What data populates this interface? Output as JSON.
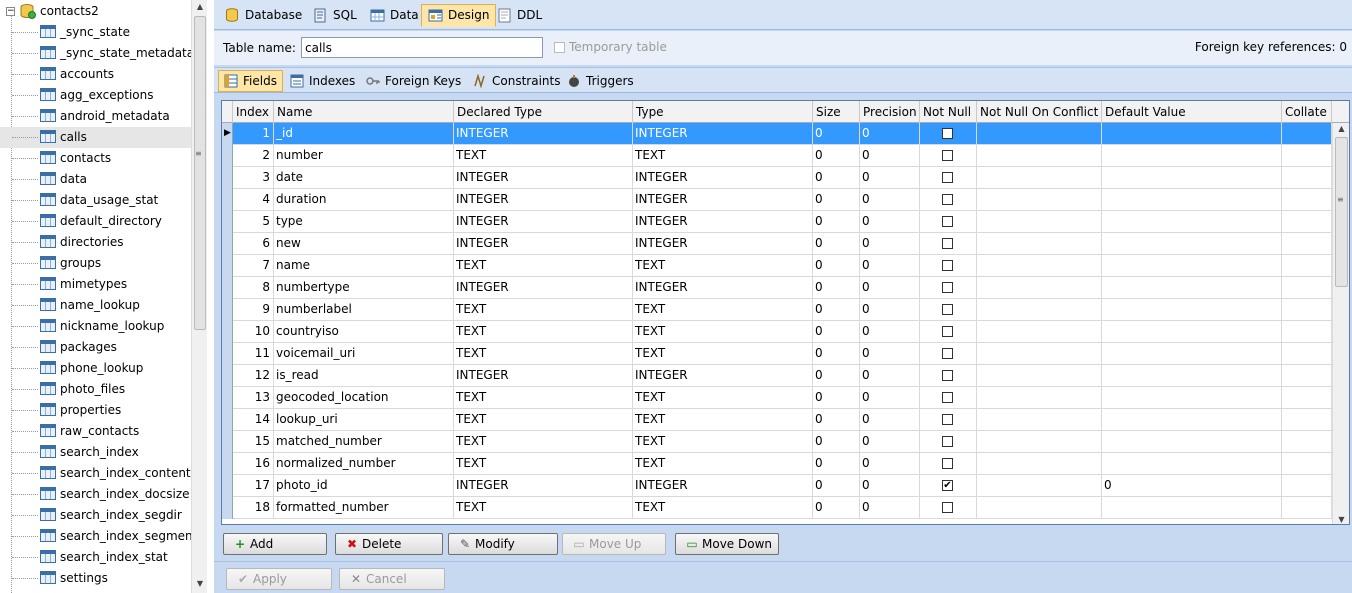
{
  "tree": {
    "root_label": "contacts2",
    "items": [
      "_sync_state",
      "_sync_state_metadata",
      "accounts",
      "agg_exceptions",
      "android_metadata",
      "calls",
      "contacts",
      "data",
      "data_usage_stat",
      "default_directory",
      "directories",
      "groups",
      "mimetypes",
      "name_lookup",
      "nickname_lookup",
      "packages",
      "phone_lookup",
      "photo_files",
      "properties",
      "raw_contacts",
      "search_index",
      "search_index_content",
      "search_index_docsize",
      "search_index_segdir",
      "search_index_segment",
      "search_index_stat",
      "settings"
    ],
    "selected": "calls"
  },
  "tabs": [
    {
      "label": "Database",
      "icon": "database-icon"
    },
    {
      "label": "SQL",
      "icon": "sql-icon"
    },
    {
      "label": "Data",
      "icon": "data-grid-icon"
    },
    {
      "label": "Design",
      "icon": "design-icon"
    },
    {
      "label": "DDL",
      "icon": "ddl-icon"
    }
  ],
  "active_tab": "Design",
  "table_name": {
    "label": "Table name:",
    "value": "calls"
  },
  "temporary_table": {
    "label": "Temporary table",
    "checked": false
  },
  "foreign_key_references": "Foreign key references: 0",
  "subtabs": [
    {
      "label": "Fields",
      "icon": "fields-icon"
    },
    {
      "label": "Indexes",
      "icon": "indexes-icon"
    },
    {
      "label": "Foreign Keys",
      "icon": "key-icon"
    },
    {
      "label": "Constraints",
      "icon": "constraints-icon"
    },
    {
      "label": "Triggers",
      "icon": "triggers-icon"
    }
  ],
  "active_subtab": "Fields",
  "grid": {
    "columns": [
      "Index",
      "Name",
      "Declared Type",
      "Type",
      "Size",
      "Precision",
      "Not Null",
      "Not Null On Conflict",
      "Default Value",
      "Collate"
    ],
    "rows": [
      {
        "index": "1",
        "name": "_id",
        "declared": "INTEGER",
        "type": "INTEGER",
        "size": "0",
        "precision": "0",
        "not_null": false,
        "conflict": "",
        "default": "",
        "collate": ""
      },
      {
        "index": "2",
        "name": "number",
        "declared": "TEXT",
        "type": "TEXT",
        "size": "0",
        "precision": "0",
        "not_null": false,
        "conflict": "",
        "default": "",
        "collate": ""
      },
      {
        "index": "3",
        "name": "date",
        "declared": "INTEGER",
        "type": "INTEGER",
        "size": "0",
        "precision": "0",
        "not_null": false,
        "conflict": "",
        "default": "",
        "collate": ""
      },
      {
        "index": "4",
        "name": "duration",
        "declared": "INTEGER",
        "type": "INTEGER",
        "size": "0",
        "precision": "0",
        "not_null": false,
        "conflict": "",
        "default": "",
        "collate": ""
      },
      {
        "index": "5",
        "name": "type",
        "declared": "INTEGER",
        "type": "INTEGER",
        "size": "0",
        "precision": "0",
        "not_null": false,
        "conflict": "",
        "default": "",
        "collate": ""
      },
      {
        "index": "6",
        "name": "new",
        "declared": "INTEGER",
        "type": "INTEGER",
        "size": "0",
        "precision": "0",
        "not_null": false,
        "conflict": "",
        "default": "",
        "collate": ""
      },
      {
        "index": "7",
        "name": "name",
        "declared": "TEXT",
        "type": "TEXT",
        "size": "0",
        "precision": "0",
        "not_null": false,
        "conflict": "",
        "default": "",
        "collate": ""
      },
      {
        "index": "8",
        "name": "numbertype",
        "declared": "INTEGER",
        "type": "INTEGER",
        "size": "0",
        "precision": "0",
        "not_null": false,
        "conflict": "",
        "default": "",
        "collate": ""
      },
      {
        "index": "9",
        "name": "numberlabel",
        "declared": "TEXT",
        "type": "TEXT",
        "size": "0",
        "precision": "0",
        "not_null": false,
        "conflict": "",
        "default": "",
        "collate": ""
      },
      {
        "index": "10",
        "name": "countryiso",
        "declared": "TEXT",
        "type": "TEXT",
        "size": "0",
        "precision": "0",
        "not_null": false,
        "conflict": "",
        "default": "",
        "collate": ""
      },
      {
        "index": "11",
        "name": "voicemail_uri",
        "declared": "TEXT",
        "type": "TEXT",
        "size": "0",
        "precision": "0",
        "not_null": false,
        "conflict": "",
        "default": "",
        "collate": ""
      },
      {
        "index": "12",
        "name": "is_read",
        "declared": "INTEGER",
        "type": "INTEGER",
        "size": "0",
        "precision": "0",
        "not_null": false,
        "conflict": "",
        "default": "",
        "collate": ""
      },
      {
        "index": "13",
        "name": "geocoded_location",
        "declared": "TEXT",
        "type": "TEXT",
        "size": "0",
        "precision": "0",
        "not_null": false,
        "conflict": "",
        "default": "",
        "collate": ""
      },
      {
        "index": "14",
        "name": "lookup_uri",
        "declared": "TEXT",
        "type": "TEXT",
        "size": "0",
        "precision": "0",
        "not_null": false,
        "conflict": "",
        "default": "",
        "collate": ""
      },
      {
        "index": "15",
        "name": "matched_number",
        "declared": "TEXT",
        "type": "TEXT",
        "size": "0",
        "precision": "0",
        "not_null": false,
        "conflict": "",
        "default": "",
        "collate": ""
      },
      {
        "index": "16",
        "name": "normalized_number",
        "declared": "TEXT",
        "type": "TEXT",
        "size": "0",
        "precision": "0",
        "not_null": false,
        "conflict": "",
        "default": "",
        "collate": ""
      },
      {
        "index": "17",
        "name": "photo_id",
        "declared": "INTEGER",
        "type": "INTEGER",
        "size": "0",
        "precision": "0",
        "not_null": true,
        "conflict": "",
        "default": "0",
        "collate": ""
      },
      {
        "index": "18",
        "name": "formatted_number",
        "declared": "TEXT",
        "type": "TEXT",
        "size": "0",
        "precision": "0",
        "not_null": false,
        "conflict": "",
        "default": "",
        "collate": ""
      }
    ],
    "selected_index": "1"
  },
  "buttons": {
    "add": "Add",
    "delete": "Delete",
    "modify": "Modify",
    "move_up": "Move Up",
    "move_down": "Move Down",
    "apply": "Apply",
    "cancel": "Cancel"
  },
  "colors": {
    "selection": "#3399ff",
    "active_tab": "#fde6a8",
    "panel": "#c6d9f1"
  }
}
